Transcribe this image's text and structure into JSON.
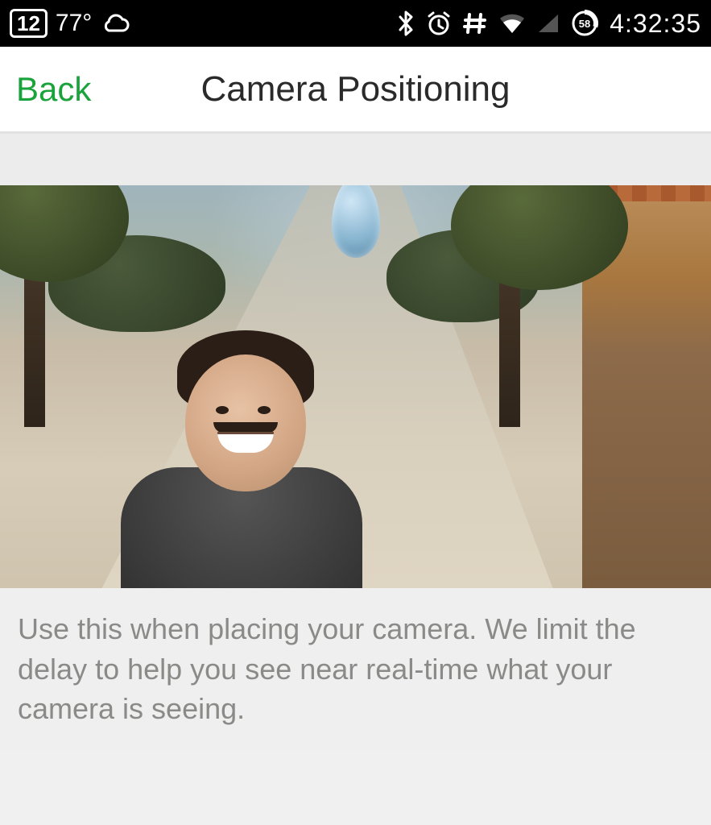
{
  "status_bar": {
    "date_badge": "12",
    "temperature": "77°",
    "battery_percent": "58",
    "clock": "4:32:35"
  },
  "header": {
    "back_label": "Back",
    "title": "Camera Positioning"
  },
  "body": {
    "description": "Use this when placing your camera.  We limit the delay to help you see near real-time what your camera is seeing."
  }
}
